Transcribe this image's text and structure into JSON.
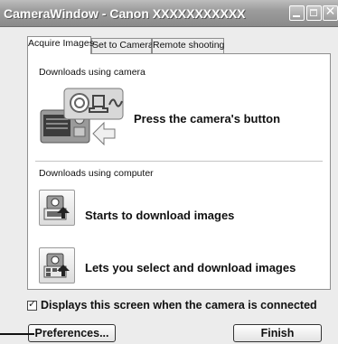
{
  "window": {
    "title": "CameraWindow - Canon XXXXXXXXXXX"
  },
  "tabs": [
    {
      "label": "Acquire Images",
      "active": true
    },
    {
      "label": "Set to Camera",
      "active": false
    },
    {
      "label": "Remote shooting",
      "active": false
    }
  ],
  "camera_section": {
    "label": "Downloads using camera",
    "action_text": "Press the camera's button"
  },
  "computer_section": {
    "label": "Downloads using computer",
    "actions": [
      {
        "label": "Starts to download images"
      },
      {
        "label": "Lets you select and download images"
      }
    ]
  },
  "startup_checkbox": {
    "checked": true,
    "label": "Displays this screen when the camera is connected"
  },
  "buttons": {
    "preferences": "Preferences...",
    "finish": "Finish"
  }
}
